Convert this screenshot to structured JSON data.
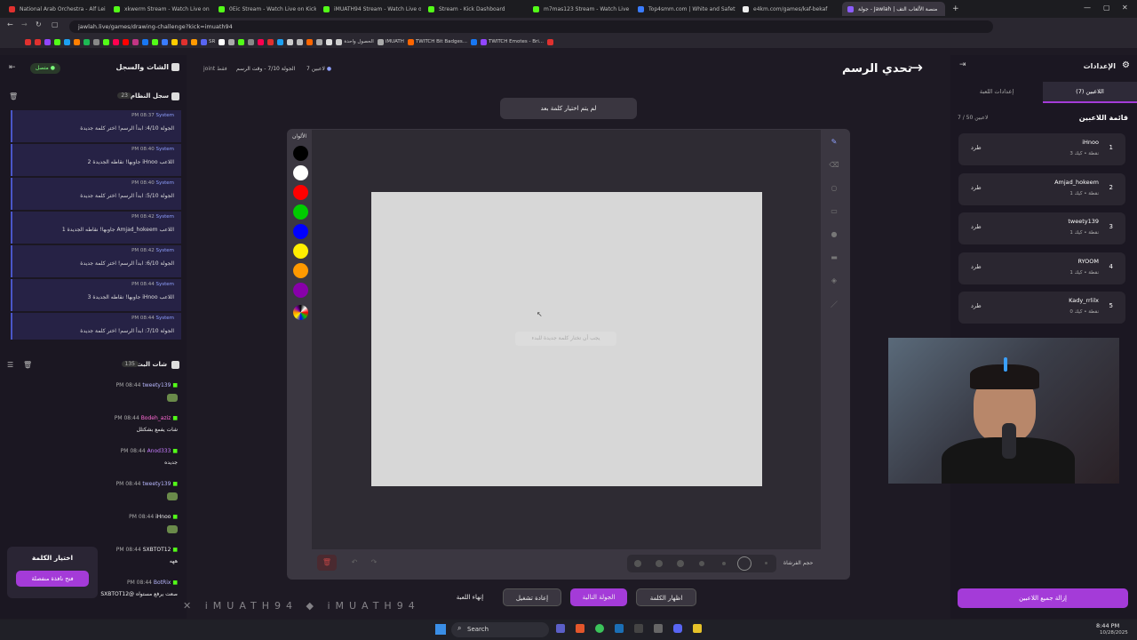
{
  "browser": {
    "tabs": [
      {
        "label": "National Arab Orchestra - Alf Lei",
        "color": "#e0312f"
      },
      {
        "label": "xkwerm Stream - Watch Live on Kick",
        "color": "#53fc18"
      },
      {
        "label": "0Eic Stream - Watch Live on Kick",
        "color": "#53fc18"
      },
      {
        "label": "iMUATH94 Stream - Watch Live o",
        "color": "#53fc18"
      },
      {
        "label": "Stream - Kick Dashboard",
        "color": "#53fc18"
      },
      {
        "label": "m7mas123 Stream - Watch Live on K",
        "color": "#53fc18"
      },
      {
        "label": "Top4smm.com | White and Safety Pa",
        "color": "#3a7cff"
      },
      {
        "label": "e4km.com/games/kaf-bekaf",
        "color": "#eee"
      },
      {
        "label": "جولة - Jawlah | منصة الألعاب التف",
        "color": "#8c5cff"
      }
    ],
    "url": "jawlah.live/games/drawing-challenge?kick=imuath94",
    "bookmarks": [
      "",
      "",
      "",
      "",
      "",
      "",
      "",
      "",
      "",
      "",
      "",
      "",
      "",
      "",
      "",
      "",
      "",
      "",
      "SR",
      "",
      "",
      "",
      "",
      "",
      "",
      "",
      "",
      "",
      "",
      "",
      "",
      "الحصول واحدة",
      "iMUATH",
      "TWITCH Bit Badges...",
      "",
      "TWITCH Emotes - Bri...",
      ""
    ]
  },
  "left": {
    "title": "الشات والسجل",
    "status": "متصل",
    "log_title": "سجل النظام",
    "log_count": "23",
    "logs": [
      {
        "time": "PM 08:37",
        "who": "System",
        "msg": "الجولة 4/10: ابدأ الرسم! اختر كلمة جديدة"
      },
      {
        "time": "PM 08:40",
        "who": "System",
        "msg": "اللاعب iHnoo جاوبها! نقاطه الجديدة 2"
      },
      {
        "time": "PM 08:40",
        "who": "System",
        "msg": "الجولة 5/10: ابدأ الرسم! اختر كلمة جديدة"
      },
      {
        "time": "PM 08:42",
        "who": "System",
        "msg": "اللاعب Amjad_hokeem جاوبها! نقاطه الجديدة 1"
      },
      {
        "time": "PM 08:42",
        "who": "System",
        "msg": "الجولة 6/10: ابدأ الرسم! اختر كلمة جديدة"
      },
      {
        "time": "PM 08:44",
        "who": "System",
        "msg": "اللاعب iHnoo جاوبها! نقاطه الجديدة 3"
      },
      {
        "time": "PM 08:44",
        "who": "System",
        "msg": "الجولة 7/10: ابدأ الرسم! اختر كلمة جديدة"
      }
    ],
    "chat_title": "شات البث",
    "chat_count": "135",
    "chat": [
      {
        "time": "PM 08:44",
        "user": "tweety139",
        "msg": "",
        "user_color": "#b9b9ff"
      },
      {
        "time": "PM 08:44",
        "user": "Bodeh_aziz",
        "msg": "شات يفمع بشكتلل",
        "user_color": "#ff6ad5"
      },
      {
        "time": "PM 08:44",
        "user": "Anod333",
        "msg": "جديده",
        "user_color": "#c77dff"
      },
      {
        "time": "PM 08:44",
        "user": "tweety139",
        "msg": "",
        "user_color": "#b9b9ff"
      },
      {
        "time": "PM 08:44",
        "user": "iHnoo",
        "msg": "",
        "user_color": "#eeeeee"
      },
      {
        "time": "PM 08:44",
        "user": "SXBTOT12",
        "msg": "ههه",
        "user_color": "#eeeeee"
      },
      {
        "time": "PM 08:44",
        "user": "BotRix",
        "msg": "SXBTOT12@ صعت يرفع مستواه",
        "user_color": "#b9b9ff"
      }
    ],
    "choose_word_title": "اختيار الكلمة",
    "open_window_btn": "فتح نافذة منفصلة"
  },
  "header": {
    "stats": {
      "players": "7 لاعبين",
      "round": "الجولة 7/10 - وقت الرسم",
      "joined": "joint فقط"
    },
    "title": "تحدي الرسم",
    "notice": "لم يتم اختيار كلمة بعد"
  },
  "canvas": {
    "colors_label": "الألوان",
    "colors": [
      "#000000",
      "#ffffff",
      "#ff0000",
      "#00cc00",
      "#0000ff",
      "#ffee00",
      "#ff9900",
      "#8800aa"
    ],
    "hint": "يجب أن تختار كلمة جديدة للبدء",
    "brush_label": "حجم الفرشاة"
  },
  "actions": {
    "finish": "إنهاء اللعبة",
    "restart": "إعادة تشغيل",
    "next": "الجولة التالية",
    "reveal": "اظهار الكلمة"
  },
  "right": {
    "title": "الإعدادات",
    "tab_players": "اللاعبين (7)",
    "tab_settings": "إعدادات اللعبة",
    "list_title": "قائمة اللاعبين",
    "capacity": "7 / 50 لاعبين",
    "kick": "طرد",
    "players": [
      {
        "rank": "1",
        "name": "iHnoo",
        "points": "3 نقطة • كيك"
      },
      {
        "rank": "2",
        "name": "Amjad_hokeem",
        "points": "1 نقطة • كيك"
      },
      {
        "rank": "3",
        "name": "tweety139",
        "points": "1 نقطة • كيك"
      },
      {
        "rank": "4",
        "name": "RYOOM",
        "points": "1 نقطة • كيك"
      },
      {
        "rank": "5",
        "name": "Kady_rrlilx",
        "points": "0 نقطة • كيك"
      }
    ],
    "remove_all": "إزالة جميع اللاعبين"
  },
  "overlay": {
    "watermark": "iMUATH94"
  },
  "taskbar": {
    "search": "Search",
    "time": "8:44 PM",
    "date": "10/28/2025"
  }
}
